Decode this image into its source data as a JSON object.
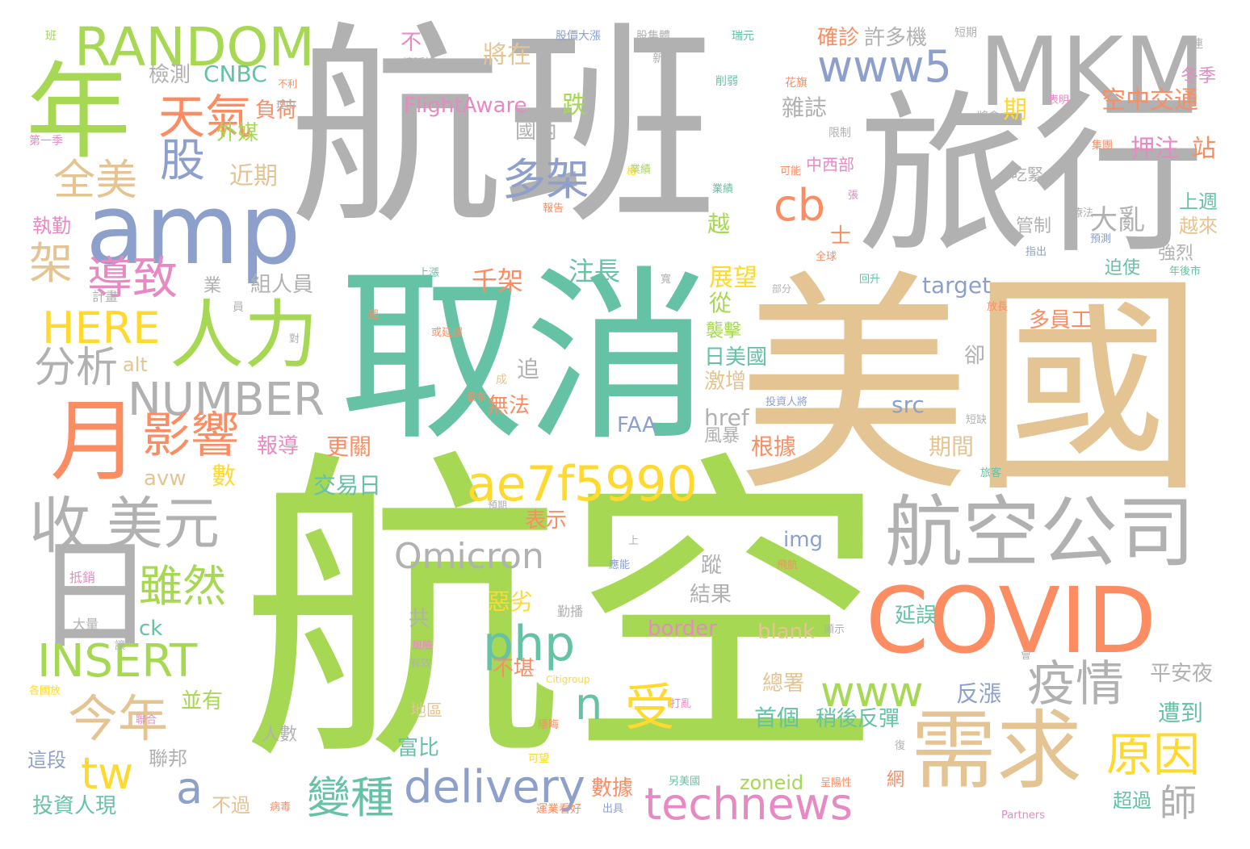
{
  "palette": {
    "gray": "#b1b1b1",
    "green": "#a6d854",
    "teal": "#66c2a5",
    "tan": "#e5c494",
    "orange": "#fc8d62",
    "blue": "#8da0cb",
    "pink": "#e78ac3",
    "yellow": "#ffd92f"
  },
  "words": [
    {
      "text": "航班",
      "color": "gray"
    },
    {
      "text": "航空",
      "color": "green"
    },
    {
      "text": "美國",
      "color": "tan"
    },
    {
      "text": "旅行",
      "color": "gray"
    },
    {
      "text": "取消",
      "color": "teal"
    },
    {
      "text": "MKM",
      "color": "gray"
    },
    {
      "text": "amp",
      "color": "blue"
    },
    {
      "text": "年",
      "color": "green"
    },
    {
      "text": "RANDOM",
      "color": "green"
    },
    {
      "text": "月",
      "color": "orange"
    },
    {
      "text": "日",
      "color": "gray"
    },
    {
      "text": "人力",
      "color": "green"
    },
    {
      "text": "COVID",
      "color": "orange"
    },
    {
      "text": "需求",
      "color": "tan"
    },
    {
      "text": "航空公司",
      "color": "gray"
    },
    {
      "text": "ae7f5990",
      "color": "yellow"
    },
    {
      "text": "NUMBER",
      "color": "gray"
    },
    {
      "text": "收",
      "color": "gray"
    },
    {
      "text": "美元",
      "color": "gray"
    },
    {
      "text": "www5",
      "color": "blue"
    },
    {
      "text": "天氣",
      "color": "orange"
    },
    {
      "text": "多架",
      "color": "blue"
    },
    {
      "text": "影響",
      "color": "orange"
    },
    {
      "text": "導致",
      "color": "pink"
    },
    {
      "text": "HERE",
      "color": "yellow"
    },
    {
      "text": "分析",
      "color": "gray"
    },
    {
      "text": "全美",
      "color": "tan"
    },
    {
      "text": "股",
      "color": "blue"
    },
    {
      "text": "架",
      "color": "tan"
    },
    {
      "text": "cb",
      "color": "orange"
    },
    {
      "text": "Omicron",
      "color": "gray"
    },
    {
      "text": "php",
      "color": "teal"
    },
    {
      "text": "INSERT",
      "color": "green"
    },
    {
      "text": "雖然",
      "color": "green"
    },
    {
      "text": "www",
      "color": "green"
    },
    {
      "text": "疫情",
      "color": "gray"
    },
    {
      "text": "原因",
      "color": "yellow"
    },
    {
      "text": "今年",
      "color": "tan"
    },
    {
      "text": "受",
      "color": "yellow"
    },
    {
      "text": "delivery",
      "color": "blue"
    },
    {
      "text": "technews",
      "color": "pink"
    },
    {
      "text": "變種",
      "color": "teal"
    },
    {
      "text": "tw",
      "color": "yellow"
    },
    {
      "text": "a",
      "color": "blue"
    },
    {
      "text": "n",
      "color": "teal"
    },
    {
      "text": "師",
      "color": "gray"
    },
    {
      "text": "大亂",
      "color": "gray"
    },
    {
      "text": "空中交通",
      "color": "orange"
    },
    {
      "text": "押注",
      "color": "pink"
    },
    {
      "text": "站",
      "color": "orange"
    },
    {
      "text": "確診",
      "color": "orange"
    },
    {
      "text": "許多機",
      "color": "gray"
    },
    {
      "text": "將在",
      "color": "tan"
    },
    {
      "text": "檢測",
      "color": "gray"
    },
    {
      "text": "CNBC",
      "color": "teal"
    },
    {
      "text": "FlightAware",
      "color": "pink"
    },
    {
      "text": "不",
      "color": "pink"
    },
    {
      "text": "跌",
      "color": "green"
    },
    {
      "text": "國內",
      "color": "gray"
    },
    {
      "text": "雜誌",
      "color": "gray"
    },
    {
      "text": "期",
      "color": "yellow"
    },
    {
      "text": "負荷",
      "color": "orange"
    },
    {
      "text": "外媒",
      "color": "green"
    },
    {
      "text": "近期",
      "color": "tan"
    },
    {
      "text": "千架",
      "color": "orange"
    },
    {
      "text": "注長",
      "color": "teal"
    },
    {
      "text": "展望",
      "color": "yellow"
    },
    {
      "text": "從",
      "color": "green"
    },
    {
      "text": "越",
      "color": "green"
    },
    {
      "text": "士",
      "color": "orange"
    },
    {
      "text": "中西部",
      "color": "pink"
    },
    {
      "text": "上週",
      "color": "teal"
    },
    {
      "text": "越來",
      "color": "tan"
    },
    {
      "text": "組人員",
      "color": "gray"
    },
    {
      "text": "target",
      "color": "blue"
    },
    {
      "text": "多員工",
      "color": "orange"
    },
    {
      "text": "日美國",
      "color": "teal"
    },
    {
      "text": "激增",
      "color": "tan"
    },
    {
      "text": "卻",
      "color": "gray"
    },
    {
      "text": "src",
      "color": "blue"
    },
    {
      "text": "href",
      "color": "gray"
    },
    {
      "text": "FAA",
      "color": "blue"
    },
    {
      "text": "根據",
      "color": "orange"
    },
    {
      "text": "期間",
      "color": "tan"
    },
    {
      "text": "追",
      "color": "gray"
    },
    {
      "text": "無法",
      "color": "orange"
    },
    {
      "text": "更關",
      "color": "orange"
    },
    {
      "text": "報導",
      "color": "pink"
    },
    {
      "text": "交易日",
      "color": "teal"
    },
    {
      "text": "數",
      "color": "yellow"
    },
    {
      "text": "avw",
      "color": "tan"
    },
    {
      "text": "alt",
      "color": "tan"
    },
    {
      "text": "表示",
      "color": "orange"
    },
    {
      "text": "img",
      "color": "blue"
    },
    {
      "text": "惡劣",
      "color": "yellow"
    },
    {
      "text": "蹤",
      "color": "gray"
    },
    {
      "text": "結果",
      "color": "gray"
    },
    {
      "text": "ck",
      "color": "teal"
    },
    {
      "text": "border",
      "color": "pink"
    },
    {
      "text": "blank",
      "color": "tan"
    },
    {
      "text": "延誤",
      "color": "teal"
    },
    {
      "text": "共",
      "color": "gray"
    },
    {
      "text": "不堪",
      "color": "orange"
    },
    {
      "text": "總署",
      "color": "tan"
    },
    {
      "text": "反漲",
      "color": "blue"
    },
    {
      "text": "平安夜",
      "color": "gray"
    },
    {
      "text": "並有",
      "color": "green"
    },
    {
      "text": "首個",
      "color": "teal"
    },
    {
      "text": "稍後反彈",
      "color": "teal"
    },
    {
      "text": "遭到",
      "color": "teal"
    },
    {
      "text": "富比",
      "color": "teal"
    },
    {
      "text": "人數",
      "color": "gray"
    },
    {
      "text": "聯邦",
      "color": "gray"
    },
    {
      "text": "這段",
      "color": "blue"
    },
    {
      "text": "數據",
      "color": "orange"
    },
    {
      "text": "zoneid",
      "color": "green"
    },
    {
      "text": "網",
      "color": "orange"
    },
    {
      "text": "超過",
      "color": "teal"
    },
    {
      "text": "不過",
      "color": "tan"
    },
    {
      "text": "投資人現",
      "color": "teal"
    },
    {
      "text": "地區",
      "color": "tan"
    },
    {
      "text": "執勤",
      "color": "pink"
    },
    {
      "text": "計畫",
      "color": "gray"
    },
    {
      "text": "業",
      "color": "gray"
    },
    {
      "text": "大量",
      "color": "gray"
    },
    {
      "text": "抵銷",
      "color": "pink"
    },
    {
      "text": "第一季",
      "color": "pink"
    },
    {
      "text": "管制",
      "color": "gray"
    },
    {
      "text": "強烈",
      "color": "gray"
    },
    {
      "text": "迫使",
      "color": "teal"
    },
    {
      "text": "吃緊",
      "color": "gray"
    },
    {
      "text": "冬季",
      "color": "pink"
    },
    {
      "text": "風暴",
      "color": "gray"
    },
    {
      "text": "襲擊",
      "color": "green"
    },
    {
      "text": "班",
      "color": "green"
    },
    {
      "text": "股價大漲",
      "color": "blue"
    },
    {
      "text": "股集體",
      "color": "gray"
    },
    {
      "text": "短期",
      "color": "gray"
    },
    {
      "text": "瑞元",
      "color": "teal"
    },
    {
      "text": "連",
      "color": "gray"
    },
    {
      "text": "續延誤",
      "color": "gray"
    },
    {
      "text": "不利",
      "color": "orange"
    },
    {
      "text": "理由",
      "color": "gray"
    },
    {
      "text": "新",
      "color": "gray"
    },
    {
      "text": "削弱",
      "color": "teal"
    },
    {
      "text": "花旗",
      "color": "orange"
    },
    {
      "text": "表明",
      "color": "pink"
    },
    {
      "text": "將會",
      "color": "gray"
    },
    {
      "text": "限制",
      "color": "gray"
    },
    {
      "text": "集團",
      "color": "orange"
    },
    {
      "text": "可能",
      "color": "orange"
    },
    {
      "text": "業績",
      "color": "teal"
    },
    {
      "text": "預測",
      "color": "blue"
    },
    {
      "text": "療法",
      "color": "gray"
    },
    {
      "text": "指出",
      "color": "blue"
    },
    {
      "text": "全球",
      "color": "orange"
    },
    {
      "text": "回升",
      "color": "teal"
    },
    {
      "text": "年後市",
      "color": "teal"
    },
    {
      "text": "部分",
      "color": "gray"
    },
    {
      "text": "寬",
      "color": "gray"
    },
    {
      "text": "上漲",
      "color": "teal"
    },
    {
      "text": "員",
      "color": "gray"
    },
    {
      "text": "對",
      "color": "gray"
    },
    {
      "text": "週",
      "color": "orange"
    },
    {
      "text": "或延誤",
      "color": "orange"
    },
    {
      "text": "放長",
      "color": "orange"
    },
    {
      "text": "投資人將",
      "color": "blue"
    },
    {
      "text": "短缺",
      "color": "gray"
    },
    {
      "text": "成",
      "color": "tan"
    },
    {
      "text": "旅客",
      "color": "teal"
    },
    {
      "text": "預期",
      "color": "gray"
    },
    {
      "text": "上",
      "color": "gray"
    },
    {
      "text": "應能",
      "color": "blue"
    },
    {
      "text": "飛航",
      "color": "orange"
    },
    {
      "text": "勤播",
      "color": "gray"
    },
    {
      "text": "顯示",
      "color": "gray"
    },
    {
      "text": "讓",
      "color": "gray"
    },
    {
      "text": "風險",
      "color": "pink"
    },
    {
      "text": "有效",
      "color": "gray"
    },
    {
      "text": "Citigroup",
      "color": "yellow"
    },
    {
      "text": "打亂",
      "color": "pink"
    },
    {
      "text": "隱晦",
      "color": "orange"
    },
    {
      "text": "可望",
      "color": "yellow"
    },
    {
      "text": "另美國",
      "color": "teal"
    },
    {
      "text": "呈陽性",
      "color": "orange"
    },
    {
      "text": "病毒",
      "color": "orange"
    },
    {
      "text": "復",
      "color": "gray"
    },
    {
      "text": "會",
      "color": "gray"
    },
    {
      "text": "Partners",
      "color": "pink"
    },
    {
      "text": "運業看好",
      "color": "orange"
    },
    {
      "text": "出具",
      "color": "blue"
    },
    {
      "text": "各國放",
      "color": "yellow"
    },
    {
      "text": "聯合",
      "color": "pink"
    },
    {
      "text": "報告",
      "color": "orange"
    },
    {
      "text": "張",
      "color": "pink"
    },
    {
      "text": "業績",
      "color": "green"
    },
    {
      "text": "格",
      "color": "yellow"
    },
    {
      "text": "發布",
      "color": "orange"
    }
  ]
}
